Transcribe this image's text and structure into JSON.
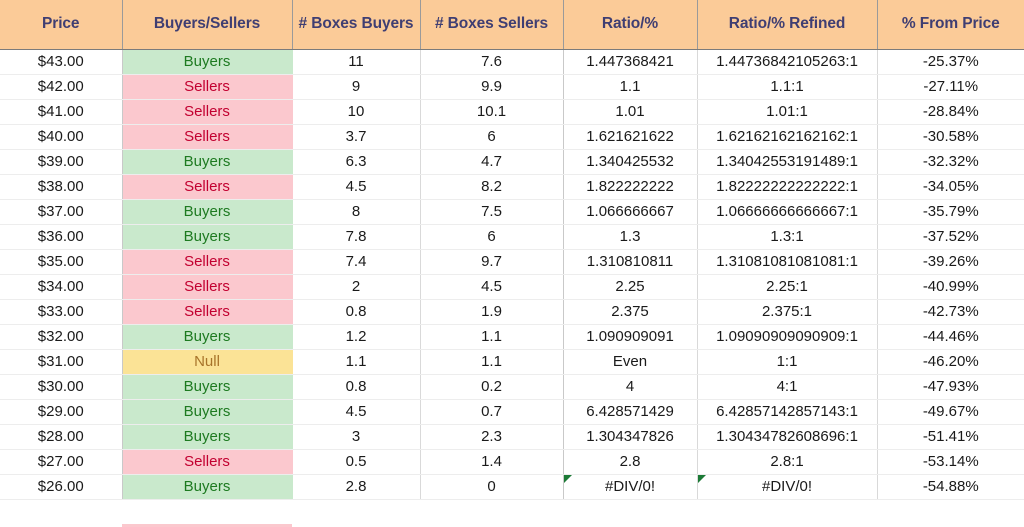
{
  "table": {
    "columns": [
      {
        "key": "price",
        "label": "Price"
      },
      {
        "key": "bs",
        "label": "Buyers/Sellers"
      },
      {
        "key": "boxbuy",
        "label": "# Boxes Buyers"
      },
      {
        "key": "boxsell",
        "label": "# Boxes Sellers"
      },
      {
        "key": "ratio",
        "label": "Ratio/%"
      },
      {
        "key": "ratioref",
        "label": "Ratio/% Refined"
      },
      {
        "key": "pctfrom",
        "label": "% From Price"
      }
    ],
    "colors": {
      "header_bg": "#fbcb98",
      "header_text": "#3f3e72",
      "buyers_bg": "#c9e9cc",
      "buyers_text": "#1d7a20",
      "sellers_bg": "#fbc8ce",
      "sellers_text": "#c20030",
      "null_bg": "#fbe396",
      "null_text": "#a8742a",
      "error_flag": "#1c7a36",
      "grid_line": "#d9d9d9"
    },
    "rows": [
      {
        "price": "$43.00",
        "bs": "Buyers",
        "bs_state": "buyers",
        "boxbuy": "11",
        "boxsell": "7.6",
        "ratio": "1.447368421",
        "ratioref": "1.44736842105263:1",
        "pctfrom": "-25.37%",
        "error": false
      },
      {
        "price": "$42.00",
        "bs": "Sellers",
        "bs_state": "sellers",
        "boxbuy": "9",
        "boxsell": "9.9",
        "ratio": "1.1",
        "ratioref": "1.1:1",
        "pctfrom": "-27.11%",
        "error": false
      },
      {
        "price": "$41.00",
        "bs": "Sellers",
        "bs_state": "sellers",
        "boxbuy": "10",
        "boxsell": "10.1",
        "ratio": "1.01",
        "ratioref": "1.01:1",
        "pctfrom": "-28.84%",
        "error": false
      },
      {
        "price": "$40.00",
        "bs": "Sellers",
        "bs_state": "sellers",
        "boxbuy": "3.7",
        "boxsell": "6",
        "ratio": "1.621621622",
        "ratioref": "1.62162162162162:1",
        "pctfrom": "-30.58%",
        "error": false
      },
      {
        "price": "$39.00",
        "bs": "Buyers",
        "bs_state": "buyers",
        "boxbuy": "6.3",
        "boxsell": "4.7",
        "ratio": "1.340425532",
        "ratioref": "1.34042553191489:1",
        "pctfrom": "-32.32%",
        "error": false
      },
      {
        "price": "$38.00",
        "bs": "Sellers",
        "bs_state": "sellers",
        "boxbuy": "4.5",
        "boxsell": "8.2",
        "ratio": "1.822222222",
        "ratioref": "1.82222222222222:1",
        "pctfrom": "-34.05%",
        "error": false
      },
      {
        "price": "$37.00",
        "bs": "Buyers",
        "bs_state": "buyers",
        "boxbuy": "8",
        "boxsell": "7.5",
        "ratio": "1.066666667",
        "ratioref": "1.06666666666667:1",
        "pctfrom": "-35.79%",
        "error": false
      },
      {
        "price": "$36.00",
        "bs": "Buyers",
        "bs_state": "buyers",
        "boxbuy": "7.8",
        "boxsell": "6",
        "ratio": "1.3",
        "ratioref": "1.3:1",
        "pctfrom": "-37.52%",
        "error": false
      },
      {
        "price": "$35.00",
        "bs": "Sellers",
        "bs_state": "sellers",
        "boxbuy": "7.4",
        "boxsell": "9.7",
        "ratio": "1.310810811",
        "ratioref": "1.31081081081081:1",
        "pctfrom": "-39.26%",
        "error": false
      },
      {
        "price": "$34.00",
        "bs": "Sellers",
        "bs_state": "sellers",
        "boxbuy": "2",
        "boxsell": "4.5",
        "ratio": "2.25",
        "ratioref": "2.25:1",
        "pctfrom": "-40.99%",
        "error": false
      },
      {
        "price": "$33.00",
        "bs": "Sellers",
        "bs_state": "sellers",
        "boxbuy": "0.8",
        "boxsell": "1.9",
        "ratio": "2.375",
        "ratioref": "2.375:1",
        "pctfrom": "-42.73%",
        "error": false
      },
      {
        "price": "$32.00",
        "bs": "Buyers",
        "bs_state": "buyers",
        "boxbuy": "1.2",
        "boxsell": "1.1",
        "ratio": "1.090909091",
        "ratioref": "1.09090909090909:1",
        "pctfrom": "-44.46%",
        "error": false
      },
      {
        "price": "$31.00",
        "bs": "Null",
        "bs_state": "null",
        "boxbuy": "1.1",
        "boxsell": "1.1",
        "ratio": "Even",
        "ratioref": "1:1",
        "pctfrom": "-46.20%",
        "error": false
      },
      {
        "price": "$30.00",
        "bs": "Buyers",
        "bs_state": "buyers",
        "boxbuy": "0.8",
        "boxsell": "0.2",
        "ratio": "4",
        "ratioref": "4:1",
        "pctfrom": "-47.93%",
        "error": false
      },
      {
        "price": "$29.00",
        "bs": "Buyers",
        "bs_state": "buyers",
        "boxbuy": "4.5",
        "boxsell": "0.7",
        "ratio": "6.428571429",
        "ratioref": "6.42857142857143:1",
        "pctfrom": "-49.67%",
        "error": false
      },
      {
        "price": "$28.00",
        "bs": "Buyers",
        "bs_state": "buyers",
        "boxbuy": "3",
        "boxsell": "2.3",
        "ratio": "1.304347826",
        "ratioref": "1.30434782608696:1",
        "pctfrom": "-51.41%",
        "error": false
      },
      {
        "price": "$27.00",
        "bs": "Sellers",
        "bs_state": "sellers",
        "boxbuy": "0.5",
        "boxsell": "1.4",
        "ratio": "2.8",
        "ratioref": "2.8:1",
        "pctfrom": "-53.14%",
        "error": false
      },
      {
        "price": "$26.00",
        "bs": "Buyers",
        "bs_state": "buyers",
        "boxbuy": "2.8",
        "boxsell": "0",
        "ratio": "#DIV/0!",
        "ratioref": "#DIV/0!",
        "pctfrom": "-54.88%",
        "error": true
      }
    ]
  }
}
